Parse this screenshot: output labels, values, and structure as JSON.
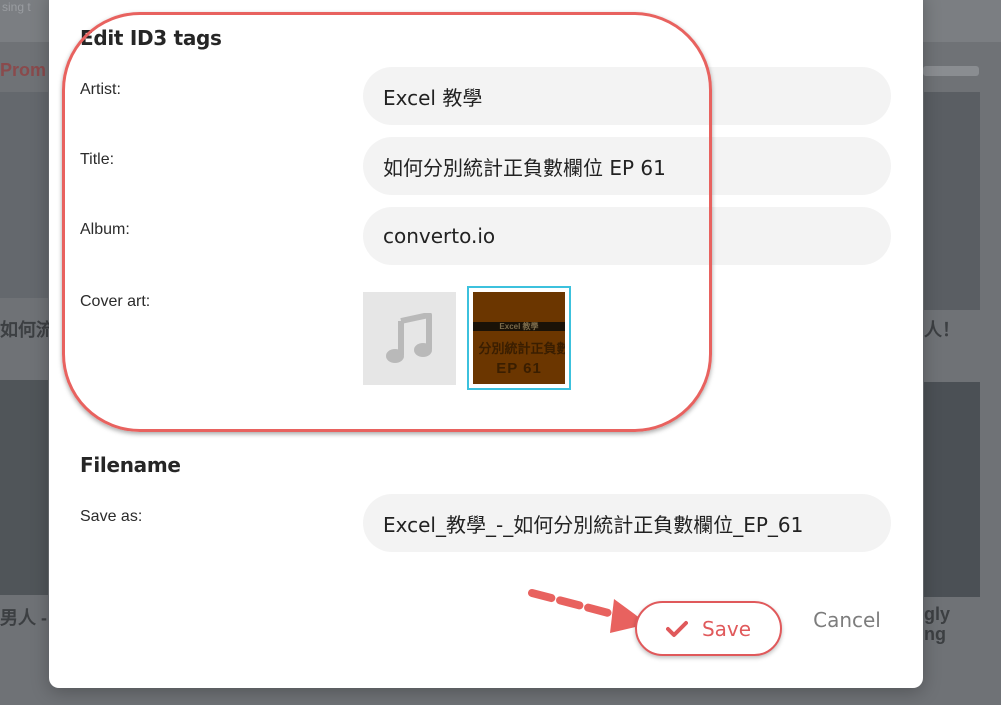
{
  "background": {
    "topbar_text": "sing t",
    "promo_text": "Prom",
    "left_caption_1": "如何流",
    "right_caption_1": "人！",
    "left_caption_2": "男人 -",
    "right_caption_2_line1": "gly",
    "right_caption_2_line2": "ng"
  },
  "id3": {
    "section_title": "Edit ID3 tags",
    "artist_label": "Artist:",
    "artist_value": "Excel 教學",
    "title_label": "Title:",
    "title_value": "如何分別統計正負數欄位 EP 61",
    "album_label": "Album:",
    "album_value": "converto.io",
    "cover_label": "Cover art:",
    "cover_default_icon": "music-note-icon",
    "cover_image_band": "Excel 教學",
    "cover_image_line1": "分別統計正負數",
    "cover_image_line2": "EP 61"
  },
  "filename": {
    "section_title": "Filename",
    "save_as_label": "Save as:",
    "save_as_value": "Excel_教學_-_如何分別統計正負數欄位_EP_61"
  },
  "actions": {
    "save_label": "Save",
    "save_icon": "checkmark-icon",
    "cancel_label": "Cancel"
  },
  "colors": {
    "accent": "#e0595b",
    "selection": "#3cc1dd",
    "annotation": "#e8625f"
  }
}
